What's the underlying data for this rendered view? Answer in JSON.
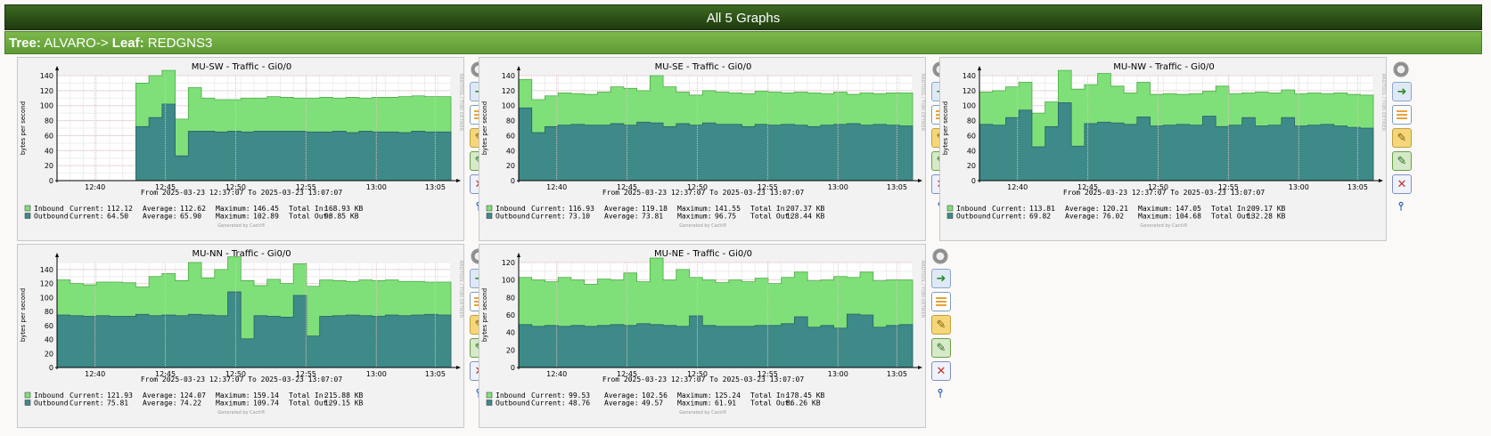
{
  "header": {
    "title": "All 5 Graphs"
  },
  "tree": {
    "tree_label": "Tree:",
    "tree_value": "ALVARO->",
    "leaf_label": "Leaf:",
    "leaf_value": "REDGNS3"
  },
  "common": {
    "ylabel": "bytes per second",
    "side_label": "RRDTOOL / TOBI OETIKER",
    "range_text": "From 2025-03-23 12:37:07 To 2025-03-23 13:07:07",
    "footer": "Generated by Cacti®",
    "inbound_label": "Inbound",
    "outbound_label": "Outbound",
    "xticks": [
      "12:40",
      "12:45",
      "12:50",
      "12:55",
      "13:00",
      "13:05"
    ],
    "colors": {
      "inbound": "#7fe07a",
      "inbound_line": "#4caa44",
      "outbound": "#3d8a88",
      "outbound_line": "#2a6260",
      "header_dark": "#1e3a0e",
      "header_light": "#6aa83c"
    }
  },
  "graphs": [
    {
      "title": "MU-SW - Traffic - Gi0/0",
      "ymax": 140,
      "ystep": 20,
      "start": 6,
      "inbound": [
        120,
        120,
        100,
        122,
        103,
        122,
        130,
        140,
        147,
        82,
        124,
        110,
        108,
        108,
        110,
        110,
        112,
        111,
        110,
        110,
        111,
        110,
        111,
        110,
        111,
        111,
        112,
        113,
        112,
        112
      ],
      "outbound": [
        82,
        82,
        50,
        79,
        57,
        66,
        72,
        84,
        102,
        33,
        66,
        66,
        65,
        66,
        65,
        66,
        66,
        66,
        66,
        65,
        65,
        66,
        64,
        66,
        65,
        65,
        64,
        66,
        65,
        65
      ],
      "legend_in": {
        "current": "112.12",
        "average": "112.62",
        "maximum": "146.45",
        "total": "168.93 KB"
      },
      "legend_out": {
        "current": "64.50",
        "average": "65.90",
        "maximum": "102.89",
        "total": "98.85 KB"
      }
    },
    {
      "title": "MU-SE - Traffic - Gi0/0",
      "ymax": 140,
      "ystep": 20,
      "start": 0,
      "inbound": [
        135,
        108,
        113,
        117,
        116,
        115,
        118,
        125,
        123,
        120,
        140,
        125,
        118,
        114,
        120,
        118,
        117,
        116,
        119,
        118,
        117,
        118,
        117,
        116,
        118,
        115,
        117,
        116,
        117,
        117
      ],
      "outbound": [
        97,
        64,
        72,
        74,
        75,
        74,
        74,
        76,
        74,
        78,
        77,
        72,
        76,
        74,
        77,
        75,
        75,
        72,
        75,
        74,
        75,
        74,
        72,
        74,
        75,
        76,
        74,
        75,
        74,
        73
      ],
      "legend_in": {
        "current": "116.93",
        "average": "119.18",
        "maximum": "141.55",
        "total": "207.37 KB"
      },
      "legend_out": {
        "current": "73.10",
        "average": "73.81",
        "maximum": "96.75",
        "total": "128.44 KB"
      }
    },
    {
      "title": "MU-NW - Traffic - Gi0/0",
      "ymax": 140,
      "ystep": 20,
      "start": 0,
      "inbound": [
        118,
        120,
        125,
        131,
        90,
        105,
        147,
        122,
        128,
        143,
        126,
        117,
        131,
        115,
        116,
        115,
        116,
        119,
        126,
        116,
        117,
        118,
        117,
        121,
        116,
        117,
        116,
        117,
        115,
        114
      ],
      "outbound": [
        75,
        74,
        84,
        94,
        45,
        72,
        104,
        46,
        76,
        78,
        77,
        75,
        85,
        73,
        74,
        75,
        74,
        86,
        72,
        74,
        84,
        73,
        74,
        84,
        73,
        74,
        75,
        73,
        71,
        70
      ],
      "legend_in": {
        "current": "113.81",
        "average": "120.21",
        "maximum": "147.05",
        "total": "209.17 KB"
      },
      "legend_out": {
        "current": "69.82",
        "average": "76.02",
        "maximum": "104.68",
        "total": "132.28 KB"
      }
    },
    {
      "title": "MU-NN - Traffic - Gi0/0",
      "ymax": 150,
      "ystep": 20,
      "start": 0,
      "inbound": [
        125,
        120,
        118,
        122,
        122,
        121,
        115,
        130,
        134,
        124,
        150,
        128,
        140,
        158,
        124,
        117,
        126,
        120,
        148,
        116,
        125,
        124,
        123,
        125,
        124,
        125,
        123,
        123,
        122,
        122
      ],
      "outbound": [
        75,
        74,
        73,
        74,
        73,
        73,
        76,
        74,
        75,
        74,
        76,
        75,
        74,
        108,
        41,
        74,
        73,
        72,
        103,
        45,
        73,
        74,
        75,
        74,
        73,
        75,
        74,
        75,
        76,
        75
      ],
      "legend_in": {
        "current": "121.93",
        "average": "124.07",
        "maximum": "159.14",
        "total": "215.88 KB"
      },
      "legend_out": {
        "current": "75.81",
        "average": "74.22",
        "maximum": "109.74",
        "total": "129.15 KB"
      }
    },
    {
      "title": "MU-NE - Traffic - Gi0/0",
      "ymax": 120,
      "ystep": 20,
      "start": 0,
      "inbound": [
        103,
        100,
        98,
        103,
        100,
        95,
        101,
        100,
        108,
        98,
        125,
        100,
        112,
        103,
        100,
        97,
        100,
        98,
        102,
        96,
        103,
        109,
        99,
        100,
        104,
        103,
        109,
        99,
        100,
        100
      ],
      "outbound": [
        49,
        47,
        48,
        47,
        48,
        47,
        48,
        49,
        48,
        50,
        49,
        48,
        47,
        59,
        48,
        47,
        47,
        47,
        48,
        48,
        50,
        58,
        46,
        48,
        45,
        61,
        60,
        46,
        48,
        49
      ],
      "legend_in": {
        "current": "99.53",
        "average": "102.56",
        "maximum": "125.24",
        "total": "178.45 KB"
      },
      "legend_out": {
        "current": "48.76",
        "average": "49.57",
        "maximum": "61.91",
        "total": "86.26 KB"
      }
    }
  ]
}
